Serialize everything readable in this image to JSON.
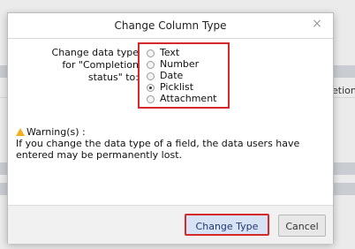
{
  "background": {
    "partial_text": "etion"
  },
  "dialog": {
    "title": "Change Column Type",
    "close_glyph": "×",
    "prompt": "Change data type for \"Completion status\" to:",
    "options": [
      {
        "label": "Text",
        "checked": false
      },
      {
        "label": "Number",
        "checked": false
      },
      {
        "label": "Date",
        "checked": false
      },
      {
        "label": "Picklist",
        "checked": true
      },
      {
        "label": "Attachment",
        "checked": false
      }
    ],
    "warning_title": "Warning(s) :",
    "warning_text": "If you change the data type of a field, the data users have entered may be permanently lost.",
    "buttons": {
      "change_type": "Change Type",
      "cancel": "Cancel"
    }
  },
  "colors": {
    "highlight_red": "#d62a2a",
    "primary_button_bg": "#d7e3f4",
    "warning_yellow": "#f2b01e"
  }
}
